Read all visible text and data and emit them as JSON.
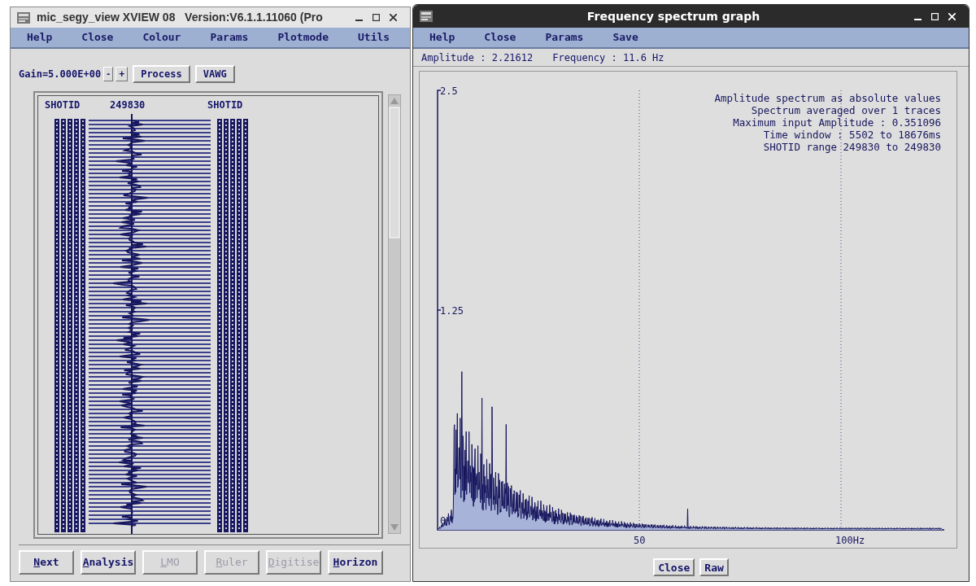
{
  "left_window": {
    "title": "mic_segy_view XVIEW 08   Version:V6.1.1.11060 (Pro",
    "menu": [
      "Help",
      "Close",
      "Colour",
      "Params",
      "Plotmode",
      "Utils"
    ],
    "gain": "Gain=5.000E+00",
    "gain_buttons": [
      "-",
      "+"
    ],
    "tool_buttons": [
      "Process",
      "VAWG"
    ],
    "display": {
      "header_labels": [
        "SHOTID",
        "249830",
        "SHOTID"
      ]
    },
    "bottom_buttons": [
      {
        "label": "Next",
        "disabled": false
      },
      {
        "label": "Analysis",
        "disabled": false
      },
      {
        "label": "LMO",
        "disabled": true
      },
      {
        "label": "Ruler",
        "disabled": true
      },
      {
        "label": "Digitise",
        "disabled": true
      },
      {
        "label": "Horizon",
        "disabled": false
      }
    ]
  },
  "right_window": {
    "title": "Frequency spectrum graph",
    "menu": [
      "Help",
      "Close",
      "Params",
      "Save"
    ],
    "readout": [
      "Amplitude : 2.21612",
      "Frequency : 11.6 Hz"
    ],
    "plot": {
      "annotations": [
        "Amplitude spectrum as absolute values",
        "Spectrum averaged over 1 traces",
        "Maximum input Amplitude : 0.351096",
        "Time window : 5502 to 18676ms",
        "SHOTID range 249830 to 249830"
      ],
      "y_labels": [
        "2.5",
        "1.25",
        "0"
      ],
      "x_labels": [
        "50",
        "100Hz"
      ]
    },
    "buttons": [
      "Close",
      "Raw"
    ]
  }
}
